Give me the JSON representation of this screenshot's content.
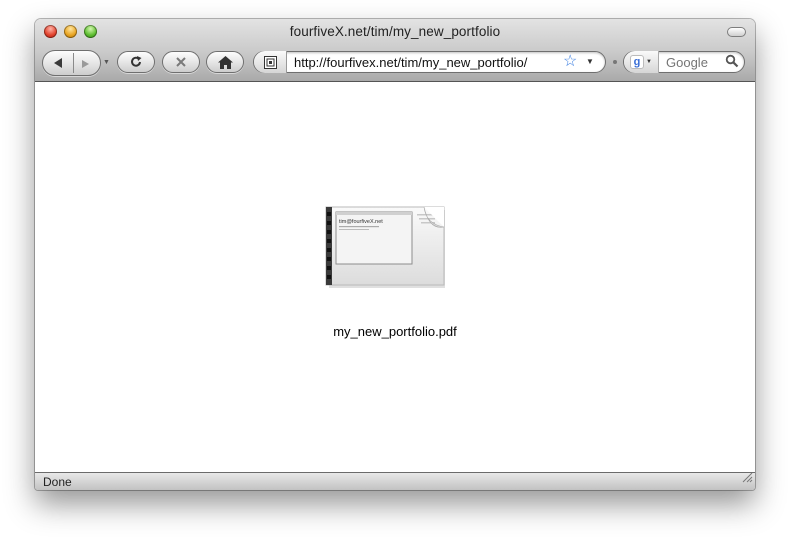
{
  "window": {
    "title": "fourfiveX.net/tim/my_new_portfolio"
  },
  "toolbar": {
    "back_icon": "back-arrow-icon",
    "forward_icon": "forward-arrow-icon",
    "history_icon": "history-dropdown-icon",
    "reload_icon": "reload-icon",
    "stop_icon": "stop-x-icon",
    "home_icon": "home-icon"
  },
  "address": {
    "url": "http://fourfivex.net/tim/my_new_portfolio/",
    "site_icon": "site-identity-icon",
    "bookmark_icon": "star-icon",
    "accent": "#3a7de0"
  },
  "search": {
    "placeholder": "Google",
    "engine_icon": "google-icon"
  },
  "content": {
    "filename": "my_new_portfolio.pdf",
    "thumbnail_title": "tim@fourfiveX.net"
  },
  "statusbar": {
    "text": "Done"
  }
}
